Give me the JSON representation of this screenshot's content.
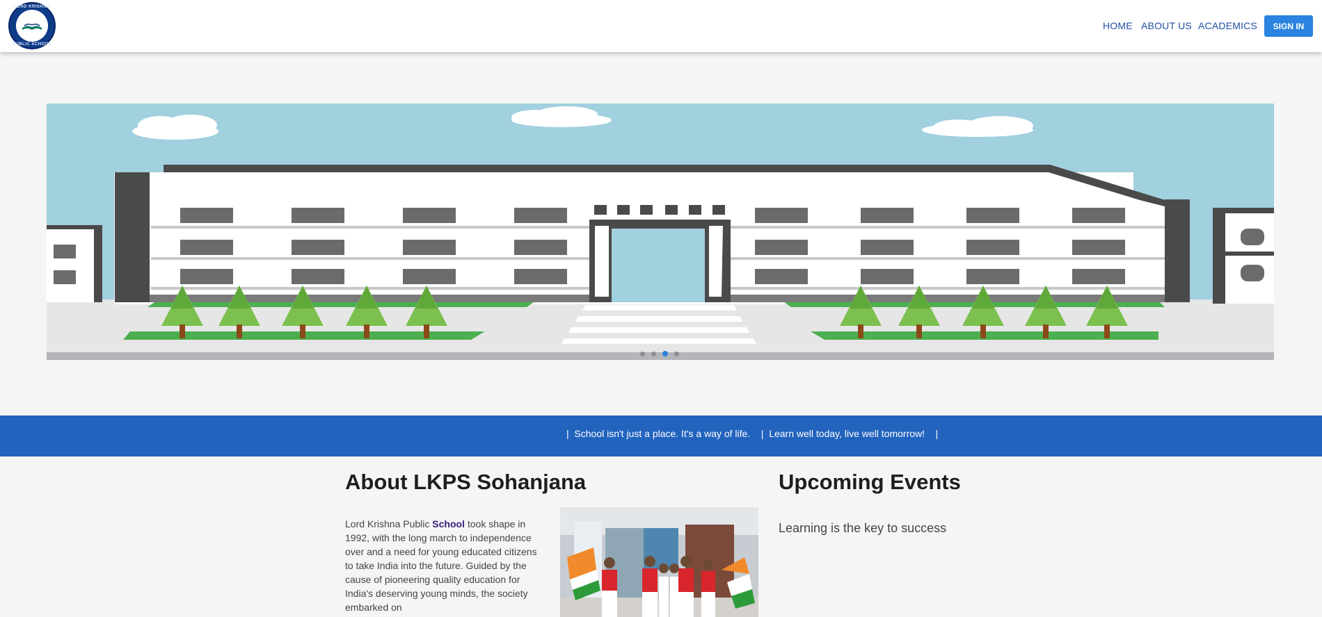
{
  "nav": {
    "logo_text_top": "LORD KRISHNA",
    "logo_text_bottom": "PUBLIC SCHOOL",
    "links": [
      "HOME",
      "ABOUT US",
      "ACADEMICS"
    ],
    "signin": "SIGN IN"
  },
  "carousel": {
    "slide_count": 4,
    "active_slide": 3
  },
  "band": {
    "text": "|  School isn't just a place. It's a way of life.    |  Learn well today, live well tomorrow!    |"
  },
  "about": {
    "title": "About LKPS Sohanjana",
    "text_before": "Lord Krishna Public ",
    "text_bold": "School",
    "text_after": " took shape in 1992, with the long march to independence over and a need for young educated citizens to take India into the future. Guided by the cause of pioneering quality education for India's deserving young minds, the society embarked on"
  },
  "events": {
    "title": "Upcoming Events",
    "item": "Learning is the key to success"
  },
  "colors": {
    "accent": "#2a83de",
    "band": "#2263be",
    "nav_link": "#1f4fa3"
  }
}
